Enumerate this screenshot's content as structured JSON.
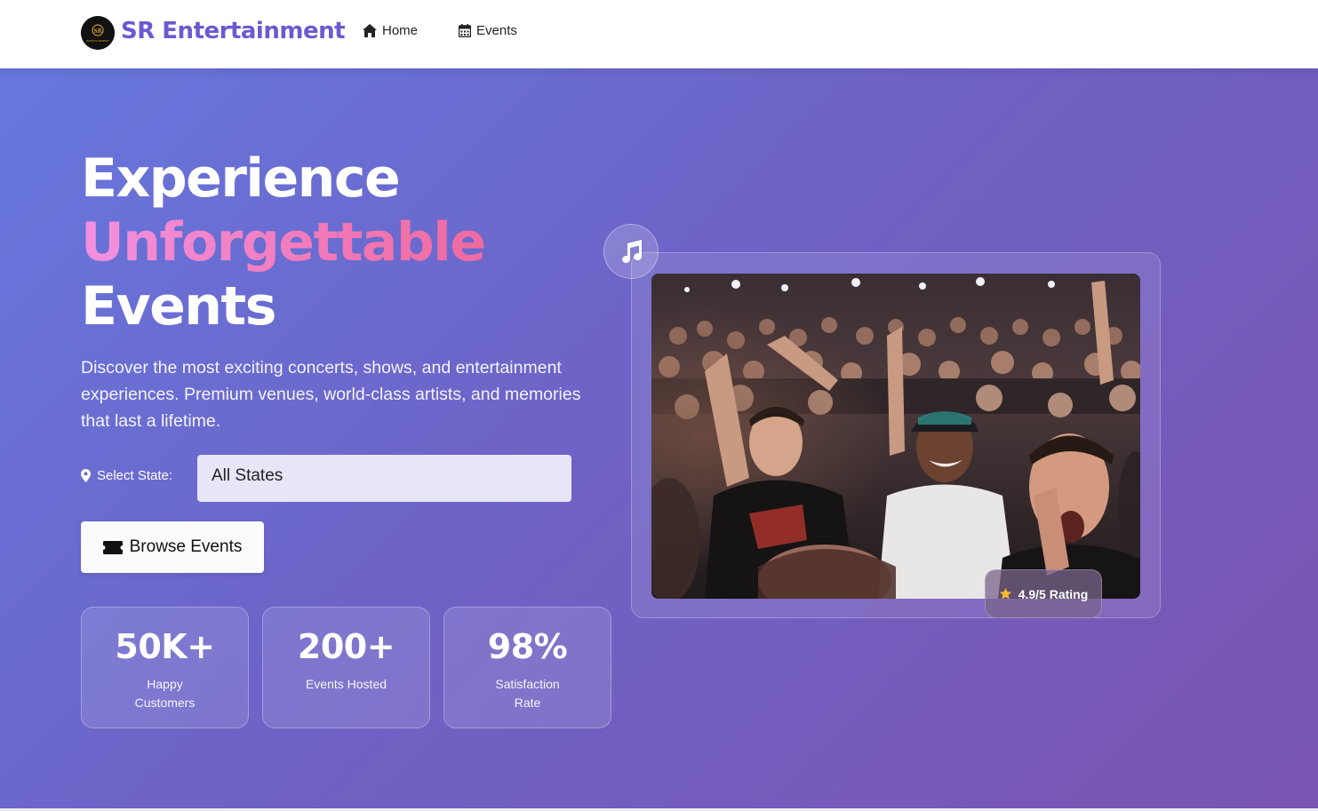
{
  "brand": {
    "name": "SR Entertainment",
    "logo_text": "SR ENTERTAINMENT"
  },
  "nav": {
    "items": [
      {
        "label": "Home",
        "icon": "home-icon"
      },
      {
        "label": "Events",
        "icon": "calendar-icon"
      }
    ]
  },
  "hero": {
    "headline_line1": "Experience",
    "headline_line2": "Unforgettable",
    "headline_line3": "Events",
    "description": "Discover the most exciting concerts, shows, and entertainment experiences. Premium venues, world-class artists, and memories that last a lifetime.",
    "state_label": "Select State:",
    "state_selected": "All States",
    "browse_button": "Browse Events",
    "rating_label": "4.9/5 Rating"
  },
  "stats": [
    {
      "value": "50K+",
      "label": "Happy Customers"
    },
    {
      "value": "200+",
      "label": "Events Hosted"
    },
    {
      "value": "98%",
      "label": "Satisfaction Rate"
    }
  ],
  "colors": {
    "brand": "#6a5ad0",
    "gradient_start": "#6677dd",
    "gradient_end": "#7a54b0",
    "headline_accent_start": "#f291e0",
    "headline_accent_end": "#f06a9e",
    "star": "#f5b82e"
  },
  "icons": {
    "location": "map-pin-icon",
    "ticket": "ticket-icon",
    "music": "music-note-icon",
    "star": "star-icon"
  }
}
